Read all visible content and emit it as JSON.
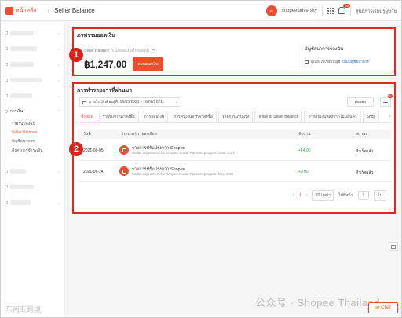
{
  "topbar": {
    "brand": "หน้าหลัก",
    "breadcrumb": "Seller Balance",
    "account": "shopeeuniversity",
    "notification_count": "99",
    "help_label": "ศูนย์การเรียนรู้ผู้ขาย"
  },
  "sidebar": {
    "section_label": "การเงิน",
    "subitems": [
      "รายรับของฉัน",
      "Seller Balance",
      "บัญชีธนาคาร",
      "ตั้งค่าการชำระเงิน"
    ]
  },
  "summary": {
    "title": "ภาพรวมยอดเงิน",
    "badge": "1",
    "seller_label": "Seller Balance",
    "seller_sub": "รวมยอดเงินทั้งหมดที่มี",
    "amount": "฿1,247.00",
    "withdraw_label": "ถอนยอดเงิน",
    "bank_title": "บัญชีธนาคารของฉัน",
    "bank_text": "คุณยังไม่เชื่อมบัญชี",
    "bank_link": "เพิ่มบัญชีธนาคาร"
  },
  "transactions": {
    "title": "การทำรายการที่ผ่านมา",
    "badge": "2",
    "date_range": "ภายใน 3 เดือน(ที่: 16/05/2021 - 16/08/2021)",
    "export_label": "ส่งออก",
    "list_badge": "5",
    "tabs": [
      "ทั้งหมด",
      "รายรับจากคำสั่งซื้อ",
      "การถอนเงิน",
      "การคืนเงินจากคำสั่งซื้อ",
      "รายการปรับปรุง",
      "จ่ายด้วย Seller Balance",
      "การคืนเงินหลังจากไม่มีสินค้า",
      "Shop"
    ],
    "columns": {
      "date": "วันที่",
      "desc": "ประเภท | รายละเอียด",
      "amount": "จำนวน",
      "status": "สถานะ"
    },
    "rows": [
      {
        "date": "2021-08-05",
        "title": "รายการปรับปรุงจาก Shopee",
        "sub": "Wallet adjustment for Shopee Social Partners program June 2021",
        "amount": "+44.00",
        "status": "สำเร็จแล้ว"
      },
      {
        "date": "2021-06-24",
        "title": "รายการปรับปรุงจาก Shopee",
        "sub": "Wallet adjustment for Shopee Social Partners program May 2021",
        "amount": "+9.00",
        "status": "สำเร็จแล้ว"
      }
    ],
    "pager": {
      "current": "1",
      "page_size": "20 / หน้า",
      "goto_label": "ไปที่หน้า",
      "goto_value": "1",
      "go_label": "ไป"
    }
  },
  "chat_label": "Chat",
  "watermark": "公众号 · Shopee Thailand",
  "watermark_left": "东南亚跨境"
}
